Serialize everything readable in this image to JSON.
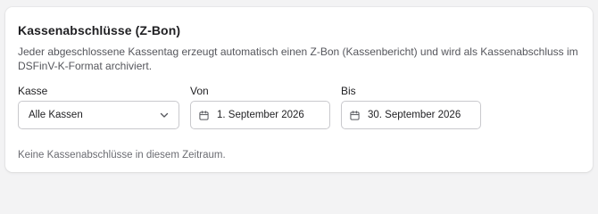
{
  "section": {
    "title": "Kassenabschlüsse (Z-Bon)",
    "description": "Jeder abgeschlossene Kassentag erzeugt automatisch einen Z-Bon (Kassenbericht) und wird als Kassenabschluss im DSFinV-K-Format archiviert."
  },
  "filters": {
    "kasse": {
      "label": "Kasse",
      "value": "Alle Kassen"
    },
    "von": {
      "label": "Von",
      "value": "1. September 2026"
    },
    "bis": {
      "label": "Bis",
      "value": "30. September 2026"
    }
  },
  "empty_state": "Keine Kassenabschlüsse in diesem Zeitraum.",
  "icons": {
    "select": "chevron-down-icon",
    "date": "calendar-icon"
  }
}
